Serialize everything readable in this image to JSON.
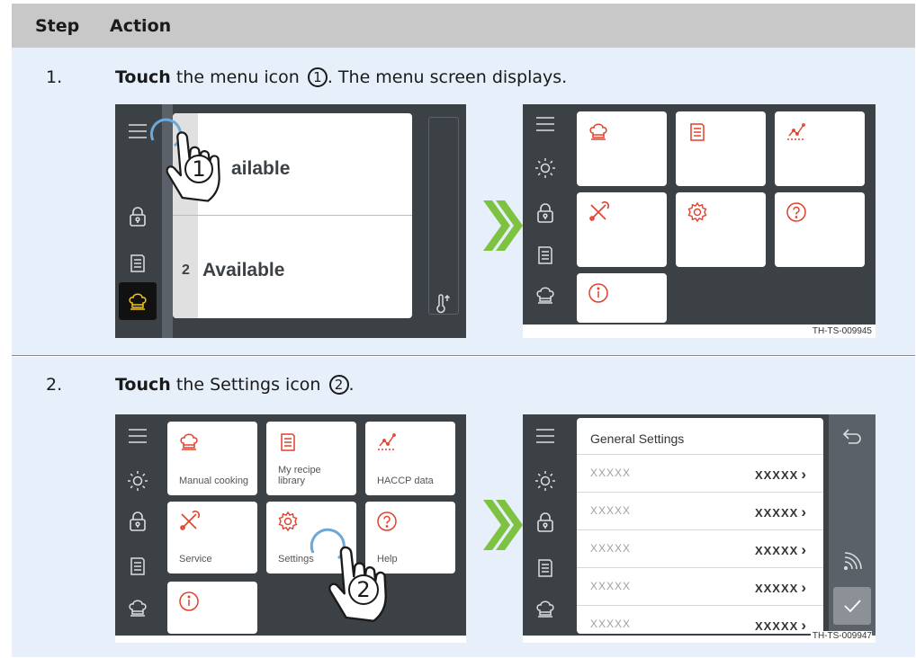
{
  "table": {
    "header": {
      "step": "Step",
      "action": "Action"
    },
    "rows": [
      {
        "num": "1.",
        "verb": "Touch",
        "text_before": "the menu icon",
        "callout": "1",
        "text_after": ". The menu screen displays.",
        "figure_id": "TH-TS-009945"
      },
      {
        "num": "2.",
        "verb": "Touch",
        "text_before": "the Settings icon",
        "callout": "2",
        "text_after": ".",
        "figure_id": "TH-TS-009947"
      }
    ]
  },
  "fig1": {
    "before": {
      "card1_text": "ailable",
      "card2_num": "2",
      "card2_text": "Available",
      "callout": "1"
    },
    "after": {
      "tiles": [
        "chef-hat-icon",
        "recipe-book-icon",
        "chart-icon",
        "tools-icon",
        "settings-icon",
        "help-icon",
        "info-icon"
      ]
    }
  },
  "fig2": {
    "menu": {
      "tiles": [
        {
          "label": "Manual cooking",
          "icon": "chef-hat-icon"
        },
        {
          "label": "My recipe library",
          "icon": "recipe-book-icon"
        },
        {
          "label": "HACCP data",
          "icon": "chart-icon"
        },
        {
          "label": "Service",
          "icon": "tools-icon"
        },
        {
          "label": "Settings",
          "icon": "settings-icon"
        },
        {
          "label": "Help",
          "icon": "help-icon"
        },
        {
          "label": "",
          "icon": "info-icon"
        }
      ],
      "callout": "2"
    },
    "settings": {
      "title": "General Settings",
      "rows": [
        {
          "key": "XXXXX",
          "value": "XXXXX"
        },
        {
          "key": "XXXXX",
          "value": "XXXXX"
        },
        {
          "key": "XXXXX",
          "value": "XXXXX"
        },
        {
          "key": "XXXXX",
          "value": "XXXXX"
        },
        {
          "key": "XXXXX",
          "value": "XXXXX"
        }
      ]
    }
  },
  "colors": {
    "accent": "#e2402b",
    "arrow": "#7ec242",
    "rail": "#3c4146",
    "header": "#c8c8c8",
    "row": "#e7effb",
    "highlight": "#f2c418"
  }
}
